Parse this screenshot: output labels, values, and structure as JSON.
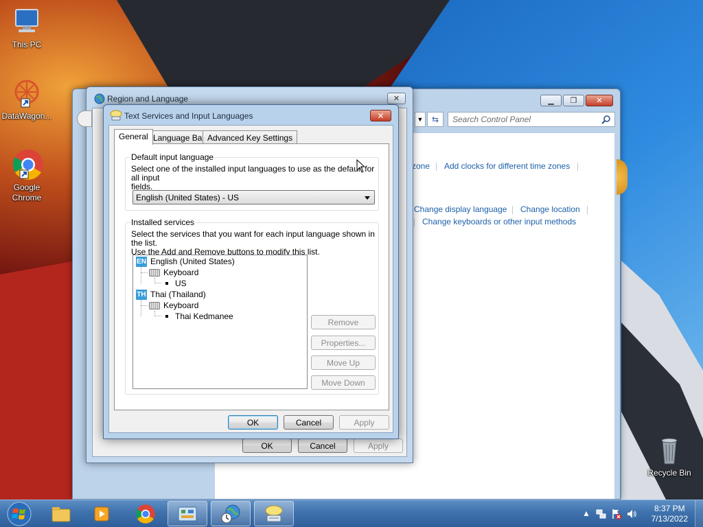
{
  "desktop": {
    "icons": [
      {
        "label": "This PC"
      },
      {
        "label": "DataWagon..."
      },
      {
        "label": "Google Chrome"
      },
      {
        "label": "Recycle Bin"
      }
    ]
  },
  "control_panel": {
    "search_placeholder": "Search Control Panel",
    "links": {
      "zone_fragment": "zone",
      "add_clocks": "Add clocks for different time zones",
      "change_display_language": "Change display language",
      "change_location": "Change location",
      "change_keyboards": "Change keyboards or other input methods"
    }
  },
  "region_language": {
    "title": "Region and Language",
    "ok_label": "OK",
    "cancel_label": "Cancel",
    "apply_label": "Apply"
  },
  "text_services": {
    "title": "Text Services and Input Languages",
    "tabs": [
      {
        "label": "General"
      },
      {
        "label": "Language Bar"
      },
      {
        "label": "Advanced Key Settings"
      }
    ],
    "default_group": {
      "title": "Default input language",
      "description_line1": "Select one of the installed input languages to use as the default for all input",
      "description_line2": "fields.",
      "selected": "English (United States) - US"
    },
    "installed_group": {
      "title": "Installed services",
      "description_line1": "Select the services that you want for each input language shown in the list.",
      "description_line2": "Use the Add and Remove buttons to modify this list.",
      "tree": [
        {
          "badge": "EN",
          "language": "English (United States)",
          "category": "Keyboard",
          "service": "US"
        },
        {
          "badge": "TH",
          "language": "Thai (Thailand)",
          "category": "Keyboard",
          "service": "Thai Kedmanee"
        }
      ],
      "buttons": {
        "remove": "Remove",
        "properties": "Properties...",
        "move_up": "Move Up",
        "move_down": "Move Down"
      }
    },
    "ok_label": "OK",
    "cancel_label": "Cancel",
    "apply_label": "Apply"
  },
  "taskbar": {
    "time": "8:37 PM",
    "date": "7/13/2022"
  }
}
